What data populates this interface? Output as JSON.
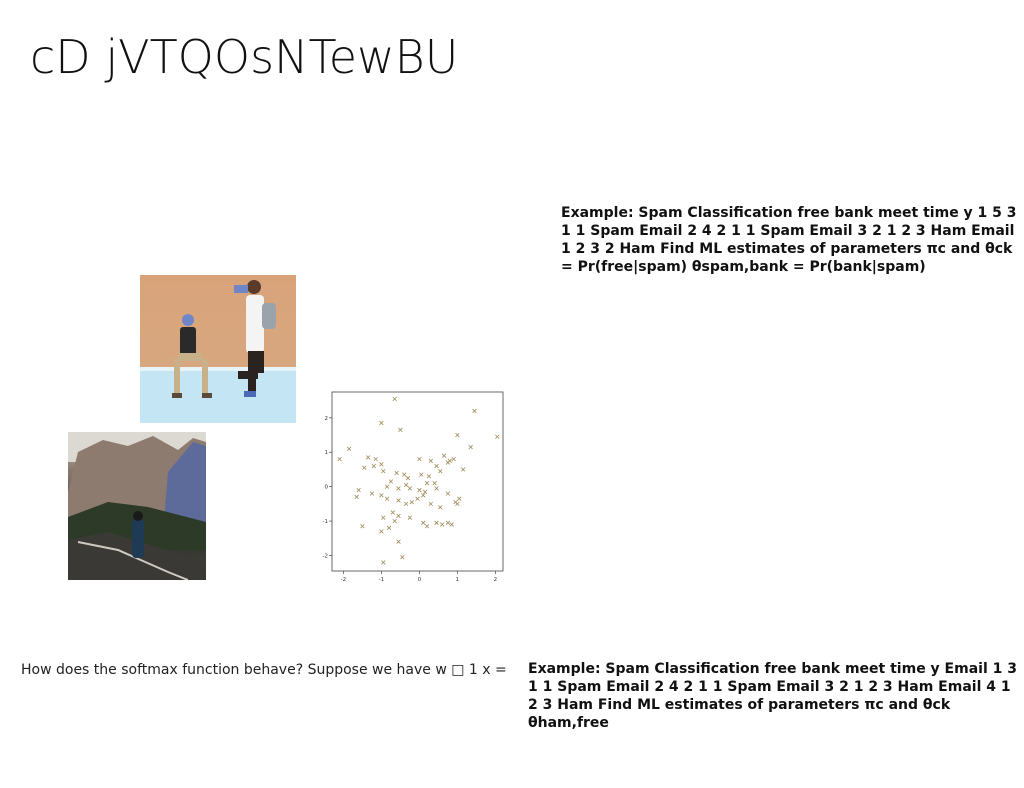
{
  "slide": {
    "title": "cD jVTQOsNTewBU",
    "top_text": "Example: Spam Classification free bank meet time y 1 5 3 1 1 Spam Email 2 4 2 1 1 Spam Email 3 2 1 2 3 Ham Email 1 2 3 2 Ham Find ML estimates of parameters πc and θck = Pr(free|spam) θspam,bank = Pr(bank|spam)",
    "question": "How does the softmax function behave? Suppose we have w □ 1 x =",
    "bottom_text": "Example: Spam Classification free bank meet time y Email 1 3 1 1 Spam Email 2 4 2 1 1 Spam Email 3 2 1 2 3 Ham Email 4 1 2 3 Ham Find ML estimates of parameters πc and θck θham,free"
  },
  "chart_data": {
    "type": "scatter",
    "marker": "x",
    "color": "#a08a5a",
    "xlim": [
      -2.3,
      2.2
    ],
    "ylim": [
      -2.45,
      2.75
    ],
    "xticks": [
      "-2",
      "-1",
      "0",
      "1",
      "2"
    ],
    "yticks": [
      "-2",
      "-1",
      "0",
      "1",
      "2"
    ],
    "points": [
      [
        -0.65,
        2.55
      ],
      [
        1.45,
        2.2
      ],
      [
        -1.0,
        1.85
      ],
      [
        -0.5,
        1.65
      ],
      [
        2.05,
        1.45
      ],
      [
        1.0,
        1.5
      ],
      [
        1.35,
        1.15
      ],
      [
        -2.1,
        0.8
      ],
      [
        -1.85,
        1.1
      ],
      [
        -1.35,
        0.85
      ],
      [
        -1.15,
        0.8
      ],
      [
        -1.0,
        0.65
      ],
      [
        -1.2,
        0.6
      ],
      [
        -1.45,
        0.55
      ],
      [
        -0.95,
        0.45
      ],
      [
        0.0,
        0.8
      ],
      [
        0.3,
        0.75
      ],
      [
        0.65,
        0.9
      ],
      [
        0.8,
        0.75
      ],
      [
        0.9,
        0.8
      ],
      [
        0.45,
        0.6
      ],
      [
        0.55,
        0.45
      ],
      [
        0.75,
        0.7
      ],
      [
        -0.6,
        0.4
      ],
      [
        -0.4,
        0.35
      ],
      [
        -0.3,
        0.25
      ],
      [
        0.05,
        0.35
      ],
      [
        0.25,
        0.3
      ],
      [
        0.4,
        0.1
      ],
      [
        -0.75,
        0.15
      ],
      [
        -0.85,
        0.0
      ],
      [
        -0.55,
        -0.05
      ],
      [
        -0.25,
        -0.05
      ],
      [
        0.0,
        -0.1
      ],
      [
        0.15,
        -0.15
      ],
      [
        0.45,
        -0.05
      ],
      [
        0.75,
        -0.2
      ],
      [
        1.05,
        -0.35
      ],
      [
        0.95,
        -0.45
      ],
      [
        1.0,
        -0.5
      ],
      [
        1.15,
        0.5
      ],
      [
        -1.6,
        -0.1
      ],
      [
        -1.65,
        -0.3
      ],
      [
        -1.25,
        -0.2
      ],
      [
        -1.0,
        -0.25
      ],
      [
        -0.85,
        -0.35
      ],
      [
        -0.55,
        -0.4
      ],
      [
        -0.35,
        -0.5
      ],
      [
        -0.2,
        -0.45
      ],
      [
        -0.05,
        -0.35
      ],
      [
        0.1,
        -0.25
      ],
      [
        0.3,
        -0.5
      ],
      [
        0.55,
        -0.6
      ],
      [
        -0.7,
        -0.75
      ],
      [
        -0.55,
        -0.85
      ],
      [
        -0.95,
        -0.9
      ],
      [
        -0.65,
        -1.0
      ],
      [
        -0.25,
        -0.9
      ],
      [
        0.1,
        -1.05
      ],
      [
        0.45,
        -1.05
      ],
      [
        0.6,
        -1.1
      ],
      [
        0.75,
        -1.05
      ],
      [
        0.85,
        -1.1
      ],
      [
        0.2,
        -1.15
      ],
      [
        -0.8,
        -1.2
      ],
      [
        -1.0,
        -1.3
      ],
      [
        -1.5,
        -1.15
      ],
      [
        -0.55,
        -1.6
      ],
      [
        -0.95,
        -2.2
      ],
      [
        -0.45,
        -2.05
      ],
      [
        -0.35,
        0.05
      ],
      [
        0.2,
        0.1
      ]
    ]
  }
}
